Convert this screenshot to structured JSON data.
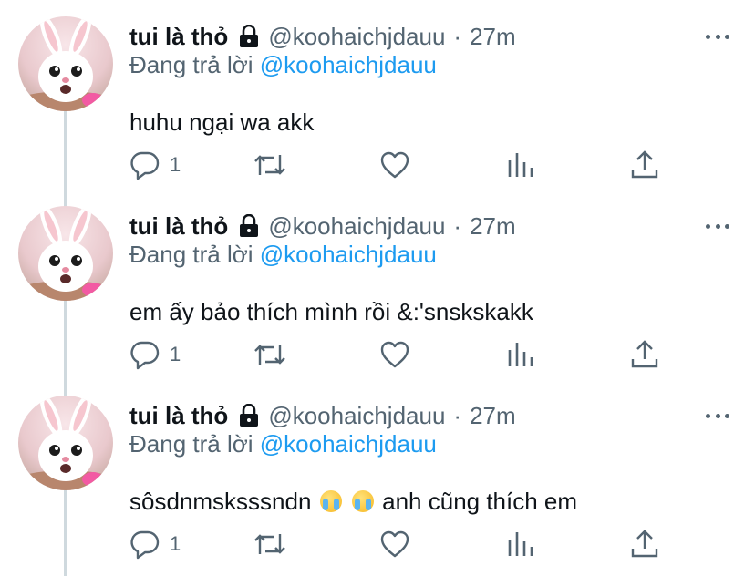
{
  "tweets": [
    {
      "name": "tui là thỏ",
      "handle": "@koohaichjdauu",
      "separator": "·",
      "time": "27m",
      "replying_prefix": "Đang trả lời ",
      "replying_to": "@koohaichjdauu",
      "text": "huhu ngại wa akk",
      "reply_count": "1"
    },
    {
      "name": "tui là thỏ",
      "handle": "@koohaichjdauu",
      "separator": "·",
      "time": "27m",
      "replying_prefix": "Đang trả lời ",
      "replying_to": "@koohaichjdauu",
      "text": "em ấy bảo thích mình rồi &:'snskskakk",
      "reply_count": "1"
    },
    {
      "name": "tui là thỏ",
      "handle": "@koohaichjdauu",
      "separator": "·",
      "time": "27m",
      "replying_prefix": "Đang trả lời ",
      "replying_to": "@koohaichjdauu",
      "text_before": "sôsdnmsksssndn",
      "text_emoji": "😭",
      "text_after": "anh cũng thích em",
      "reply_count": "1"
    }
  ],
  "icons": {
    "reply": "speech-bubble-icon",
    "retweet": "retweet-arrows-icon",
    "like": "heart-icon",
    "views": "bar-chart-icon",
    "share": "upload-share-icon",
    "lock": "lock-icon",
    "more": "more-dots-icon"
  },
  "colors": {
    "text_primary": "#0f1419",
    "text_secondary": "#536471",
    "mention": "#1d9bf0",
    "thread_line": "#cfd9de"
  }
}
